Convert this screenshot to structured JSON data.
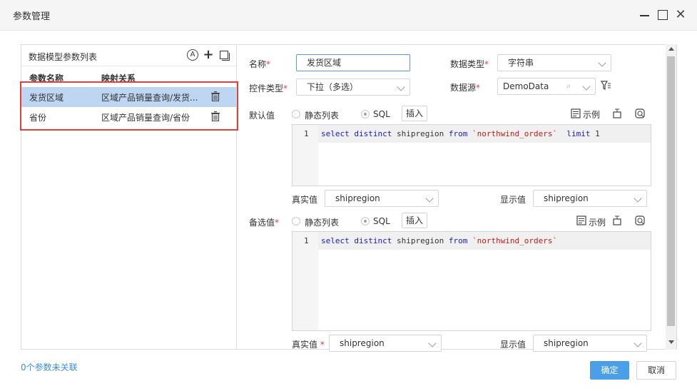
{
  "window": {
    "title": "参数管理"
  },
  "left_panel": {
    "title": "数据模型参数列表",
    "columns": {
      "name": "参数名称",
      "mapping": "映射关系"
    },
    "rows": [
      {
        "name": "发货区域",
        "mapping": "区域产品销量查询/发货...",
        "selected": true
      },
      {
        "name": "省份",
        "mapping": "区域产品销量查询/省份",
        "selected": false
      }
    ]
  },
  "form": {
    "name_label": "名称",
    "name_value": "发货区域",
    "data_type_label": "数据类型",
    "data_type_value": "字符串",
    "control_type_label": "控件类型",
    "control_type_value": "下拉（多选）",
    "datasource_label": "数据源",
    "datasource_value": "DemoData",
    "required_mark": "*",
    "default": {
      "label": "默认值",
      "static_list_label": "静态列表",
      "sql_label": "SQL",
      "insert_label": "插入",
      "example_label": "示例",
      "line_no": "1",
      "sql_kw1": "select distinct",
      "sql_field": " shipregion ",
      "sql_kw2": "from",
      "sql_table": "`northwind_orders`",
      "sql_kw3": "limit",
      "sql_tail": " 1",
      "real_value_label": "真实值",
      "real_value": "shipregion",
      "display_value_label": "显示值",
      "display_value": "shipregion"
    },
    "alternative": {
      "label": "备选值",
      "static_list_label": "静态列表",
      "sql_label": "SQL",
      "insert_label": "插入",
      "example_label": "示例",
      "line_no": "1",
      "sql_kw1": "select distinct",
      "sql_field": " shipregion ",
      "sql_kw2": "from",
      "sql_table": "`northwind_orders`",
      "real_value_label": "真实值",
      "real_value": "shipregion",
      "display_value_label": "显示值",
      "display_value": "shipregion"
    }
  },
  "footer": {
    "unlinked_text": "0个参数未关联",
    "ok_label": "确定",
    "cancel_label": "取消"
  },
  "colors": {
    "accent": "#4b9fe8",
    "selection": "#bed6f2",
    "highlight_border": "#e04040"
  }
}
